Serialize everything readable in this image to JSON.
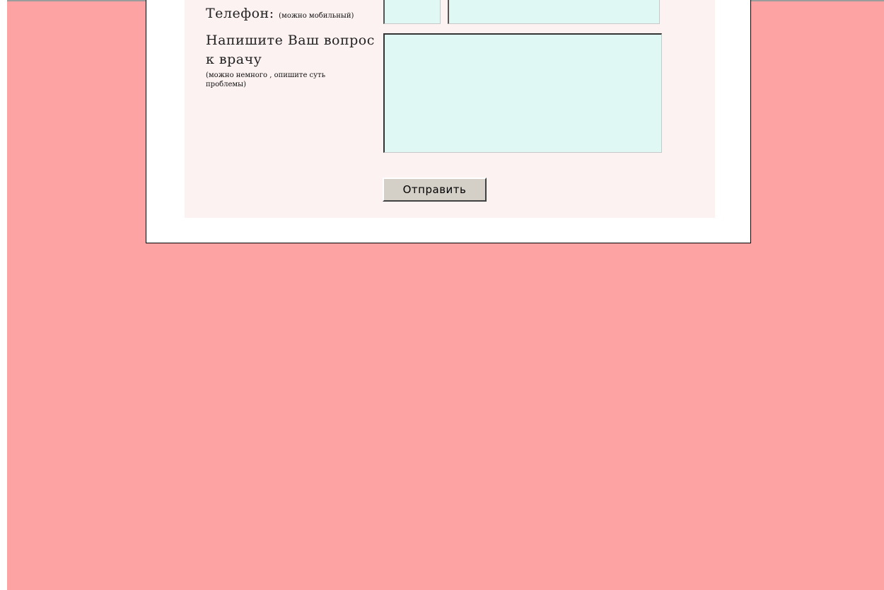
{
  "form": {
    "phone_label": "Телефон:",
    "phone_hint": "(можно мобильный)",
    "phone_code_value": "",
    "phone_number_value": "",
    "question_label": "Напишите Ваш вопрос к врачу",
    "question_hint": "(можно немного , опишите суть проблемы)",
    "question_value": "",
    "submit_label": "Отправить"
  },
  "colors": {
    "page_background": "#fea3a3",
    "panel_background": "#fdf2f2",
    "input_background": "#e0f8f4",
    "button_background": "#d4d0c8"
  }
}
